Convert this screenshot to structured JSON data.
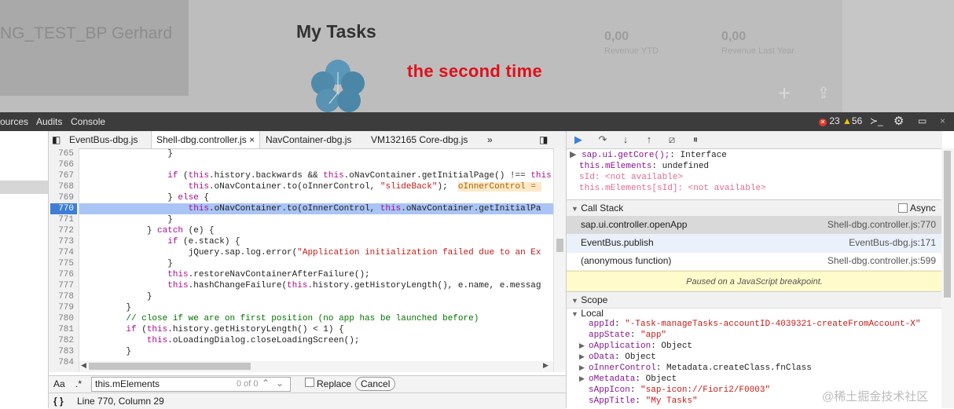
{
  "app": {
    "user_name": "NG_TEST_BP Gerhard",
    "page_title": "My Tasks",
    "annotation": "the second time",
    "kpis": [
      {
        "value": "0,00",
        "label": "Revenue YTD"
      },
      {
        "value": "0,00",
        "label": "Revenue Last Year"
      }
    ],
    "icons": [
      "add-icon",
      "share-icon"
    ]
  },
  "devtools": {
    "panel_tabs": [
      "ources",
      "Audits",
      "Console"
    ],
    "error_count": "23",
    "warning_count": "56",
    "file_tabs": [
      {
        "label": "EventBus-dbg.js",
        "active": false
      },
      {
        "label": "Shell-dbg.controller.js",
        "active": true,
        "close": "×"
      },
      {
        "label": "NavContainer-dbg.js",
        "active": false
      },
      {
        "label": "VM132165 Core-dbg.js",
        "active": false
      }
    ],
    "more_tabs": "»",
    "line_numbers": [
      "765",
      "766",
      "767",
      "768",
      "769",
      "770",
      "771",
      "772",
      "773",
      "774",
      "775",
      "776",
      "777",
      "778",
      "779",
      "780",
      "781",
      "782",
      "783",
      "784"
    ],
    "breakpoint_line": "770",
    "search": {
      "case_label": "Aa",
      "regex_label": ".*",
      "value": "this.mElements",
      "match_count": "0 of 0",
      "replace_label": "Replace",
      "cancel_label": "Cancel"
    },
    "status": {
      "braces": "{ }",
      "position": "Line 770, Column 29"
    }
  },
  "debugger": {
    "watch": [
      {
        "expr": "sap.ui.getCore();",
        "value": ": Interface",
        "expandable": true
      },
      {
        "expr": "this.mElements",
        "value": ": undefined",
        "expandable": false
      },
      {
        "expr": "sId",
        "value": ": <not available>",
        "expandable": false
      },
      {
        "expr": "this.mElements[sId]",
        "value": ": <not available>",
        "expandable": false
      }
    ],
    "call_stack_title": "Call Stack",
    "async_label": "Async",
    "call_stack": [
      {
        "fn": "sap.ui.controller.openApp",
        "loc": "Shell-dbg.controller.js:770"
      },
      {
        "fn": "EventBus.publish",
        "loc": "EventBus-dbg.js:171"
      },
      {
        "fn": "(anonymous function)",
        "loc": "Shell-dbg.controller.js:599"
      }
    ],
    "paused_message": "Paused on a JavaScript breakpoint.",
    "scope_title": "Scope",
    "scope_local": "Local",
    "scope_vars": [
      {
        "name": "appId",
        "value": "\"-Task-manageTasks-accountID-4039321-createFromAccount-X\"",
        "type": "string",
        "expandable": false
      },
      {
        "name": "appState",
        "value": "\"app\"",
        "type": "string",
        "expandable": false
      },
      {
        "name": "oApplication",
        "value": "Object",
        "type": "object",
        "expandable": true
      },
      {
        "name": "oData",
        "value": "Object",
        "type": "object",
        "expandable": true
      },
      {
        "name": "oInnerControl",
        "value": "Metadata.createClass.fnClass",
        "type": "object",
        "expandable": true
      },
      {
        "name": "oMetadata",
        "value": "Object",
        "type": "object",
        "expandable": true
      },
      {
        "name": "sAppIcon",
        "value": "\"sap-icon://Fiori2/F0003\"",
        "type": "string",
        "expandable": false
      },
      {
        "name": "sAppTitle",
        "value": "\"My Tasks\"",
        "type": "string",
        "expandable": false
      }
    ]
  },
  "watermark": "@稀土掘金技术社区"
}
